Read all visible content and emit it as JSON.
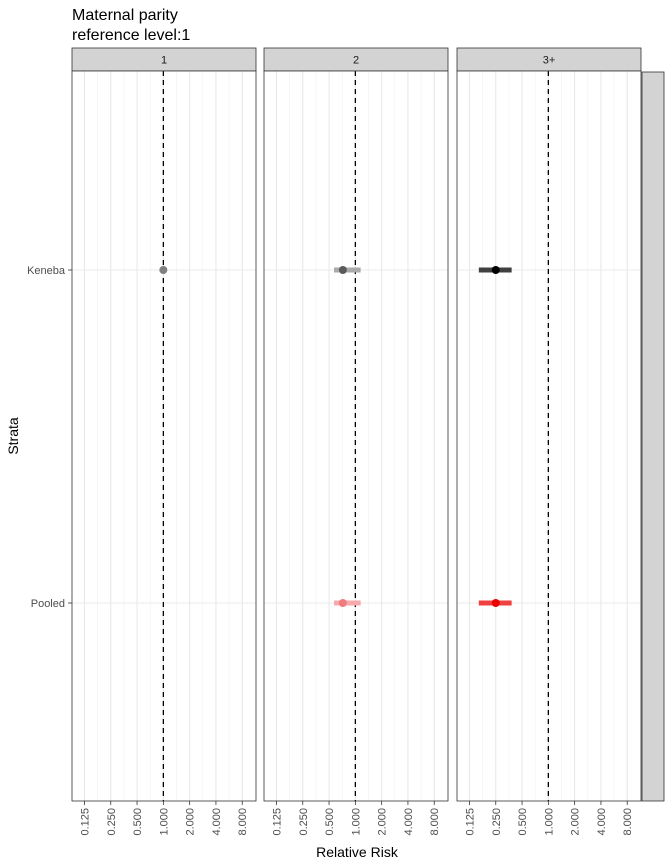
{
  "chart_data": {
    "type": "forest",
    "title": "Maternal parity\nreference level:1",
    "xlabel": "Relative Risk",
    "ylabel": "Strata",
    "x_scale": "log2",
    "x_ticks": [
      "0.125",
      "0.250",
      "0.500",
      "1.000",
      "2.000",
      "4.000",
      "8.000"
    ],
    "xlim": [
      0.09,
      11.5
    ],
    "reference_line": 1.0,
    "strata": [
      "Keneba",
      "Pooled"
    ],
    "panels": [
      {
        "label": "1",
        "rows": [
          {
            "stratum": "Keneba",
            "rr": 1.0,
            "lower": 1.0,
            "upper": 1.0,
            "color": "#808080"
          }
        ]
      },
      {
        "label": "2",
        "rows": [
          {
            "stratum": "Keneba",
            "rr": 0.72,
            "lower": 0.57,
            "upper": 1.15,
            "color": "#5a5a5a",
            "bar_color": "#aaaaaa"
          },
          {
            "stratum": "Pooled",
            "rr": 0.72,
            "lower": 0.57,
            "upper": 1.15,
            "color": "#f07c80",
            "bar_color": "#f7aaac"
          }
        ]
      },
      {
        "label": "3+",
        "rows": [
          {
            "stratum": "Keneba",
            "rr": 0.25,
            "lower": 0.16,
            "upper": 0.38,
            "color": "#000000",
            "bar_color": "#404040"
          },
          {
            "stratum": "Pooled",
            "rr": 0.25,
            "lower": 0.16,
            "upper": 0.38,
            "color": "#ee0000",
            "bar_color": "#f04040"
          }
        ]
      }
    ],
    "grid": true
  }
}
